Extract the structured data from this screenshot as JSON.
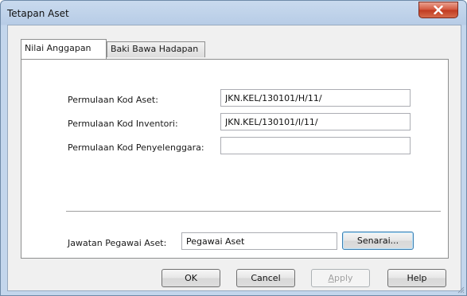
{
  "window": {
    "title": "Tetapan Aset"
  },
  "tabs": [
    {
      "label": "Nilai Anggapan",
      "active": true
    },
    {
      "label": "Baki Bawa Hadapan",
      "active": false
    }
  ],
  "form": {
    "kod_aset": {
      "label": "Permulaan Kod Aset:",
      "value": "JKN.KEL/130101/H/11/"
    },
    "kod_inventori": {
      "label": "Permulaan Kod Inventori:",
      "value": "JKN.KEL/130101/I/11/"
    },
    "kod_penyelenggara": {
      "label": "Permulaan Kod Penyelenggara:",
      "value": ""
    },
    "jawatan": {
      "label": "Jawatan Pegawai Aset:",
      "value": "Pegawai Aset"
    },
    "senarai_button": "Senarai..."
  },
  "buttons": {
    "ok": "OK",
    "cancel": "Cancel",
    "apply_first": "A",
    "apply_rest": "pply",
    "help": "Help"
  },
  "colors": {
    "close_button": "#c8472d",
    "focus_border": "#3c7fb1"
  }
}
